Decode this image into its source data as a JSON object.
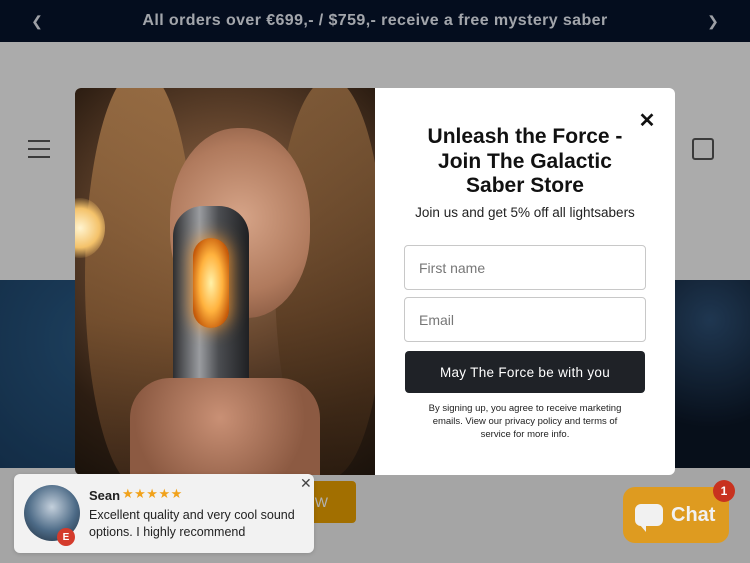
{
  "announcement": {
    "text": "All orders over €699,- / $759,- receive a free mystery saber",
    "prev_icon": "chevron-left-icon",
    "next_icon": "chevron-right-icon",
    "bg_color": "#07142b"
  },
  "header": {
    "menu_icon": "hamburger-icon",
    "cart_icon": "cart-icon"
  },
  "hero": {
    "button_label": "W"
  },
  "popup": {
    "title": "Unleash the Force - Join The Galactic Saber Store",
    "subtitle": "Join us and get 5% off all lightsabers",
    "first_name_placeholder": "First name",
    "email_placeholder": "Email",
    "submit_label": "May The Force be with you",
    "legal": "By signing up, you agree to receive marketing emails. View our privacy policy and terms of service for more info.",
    "close_glyph": "✕",
    "button_color": "#1f2227"
  },
  "review": {
    "name": "Sean",
    "rating": 5,
    "stars": "★★★★★",
    "text": "Excellent quality and very cool sound options. I highly recommend",
    "badge": "E",
    "close_glyph": "✕",
    "star_color": "#f1a21b"
  },
  "chat": {
    "label": "Chat",
    "unread_count": "1",
    "color": "#e89a09"
  }
}
